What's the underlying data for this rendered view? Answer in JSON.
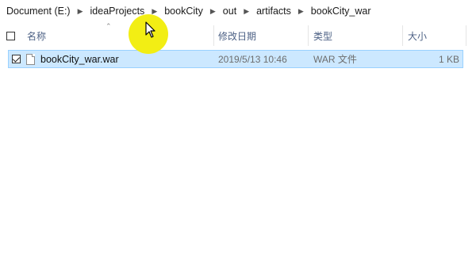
{
  "breadcrumb": [
    "Document (E:)",
    "ideaProjects",
    "bookCity",
    "out",
    "artifacts",
    "bookCity_war"
  ],
  "columns": {
    "name": "名称",
    "modified": "修改日期",
    "type": "类型",
    "size": "大小"
  },
  "files": [
    {
      "name": "bookCity_war.war",
      "modified": "2019/5/13 10:46",
      "type": "WAR 文件",
      "size": "1 KB",
      "selected": true
    }
  ],
  "colors": {
    "selection_bg": "#cce8ff",
    "selection_border": "#99d1ff",
    "header_text": "#4d6185",
    "cursor_highlight": "#f2ee14"
  },
  "icons": [
    "chevron-right-icon",
    "sort-up-icon",
    "file-icon",
    "checkbox-icon",
    "mouse-cursor-icon"
  ]
}
